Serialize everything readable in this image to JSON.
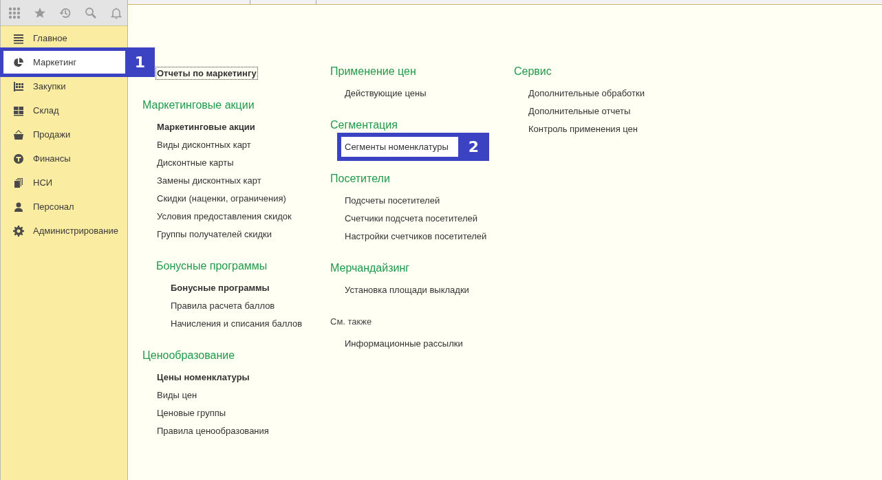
{
  "sidebar": {
    "items": [
      {
        "label": "Главное",
        "selected": false
      },
      {
        "label": "Маркетинг",
        "selected": true,
        "callout": "1"
      },
      {
        "label": "Закупки",
        "selected": false
      },
      {
        "label": "Склад",
        "selected": false
      },
      {
        "label": "Продажи",
        "selected": false
      },
      {
        "label": "Финансы",
        "selected": false
      },
      {
        "label": "НСИ",
        "selected": false
      },
      {
        "label": "Персонал",
        "selected": false
      },
      {
        "label": "Администрирование",
        "selected": false
      }
    ]
  },
  "columns": [
    {
      "entries": [
        {
          "kind": "link",
          "label": "Отчеты по маркетингу",
          "bold": true,
          "focused": true
        },
        {
          "kind": "group",
          "heading": "Маркетинговые акции",
          "items": [
            {
              "label": "Маркетинговые акции",
              "bold": true
            },
            {
              "label": "Виды дисконтных карт",
              "bold": false
            },
            {
              "label": "Дисконтные карты",
              "bold": false
            },
            {
              "label": "Замены дисконтных карт",
              "bold": false
            },
            {
              "label": "Скидки (наценки, ограничения)",
              "bold": false
            },
            {
              "label": "Условия предоставления скидок",
              "bold": false
            },
            {
              "label": "Группы получателей скидки",
              "bold": false
            }
          ],
          "children": [
            {
              "heading": "Бонусные программы",
              "items": [
                {
                  "label": "Бонусные программы",
                  "bold": true
                },
                {
                  "label": "Правила расчета баллов",
                  "bold": false
                },
                {
                  "label": "Начисления и списания баллов",
                  "bold": false
                }
              ]
            }
          ]
        },
        {
          "kind": "group",
          "heading": "Ценообразование",
          "items": [
            {
              "label": "Цены номенклатуры",
              "bold": true
            },
            {
              "label": "Виды цен",
              "bold": false
            },
            {
              "label": "Ценовые группы",
              "bold": false
            },
            {
              "label": "Правила ценообразования",
              "bold": false
            }
          ]
        }
      ]
    },
    {
      "entries": [
        {
          "kind": "group",
          "heading": "Применение цен",
          "items": [
            {
              "label": "Действующие цены",
              "bold": false
            }
          ]
        },
        {
          "kind": "group",
          "heading": "Сегментация",
          "items": [
            {
              "label": "Сегменты номенклатуры",
              "bold": false,
              "callout": "2"
            }
          ]
        },
        {
          "kind": "group",
          "heading": "Посетители",
          "items": [
            {
              "label": "Подсчеты посетителей",
              "bold": false
            },
            {
              "label": "Счетчики подсчета посетителей",
              "bold": false
            },
            {
              "label": "Настройки счетчиков посетителей",
              "bold": false
            }
          ]
        },
        {
          "kind": "group",
          "heading": "Мерчандайзинг",
          "items": [
            {
              "label": "Установка площади выкладки",
              "bold": false
            }
          ]
        },
        {
          "kind": "see-also",
          "heading": "См. также",
          "items": [
            {
              "label": "Информационные рассылки",
              "bold": false
            }
          ]
        }
      ]
    },
    {
      "entries": [
        {
          "kind": "group",
          "heading": "Сервис",
          "items": [
            {
              "label": "Дополнительные обработки",
              "bold": false
            },
            {
              "label": "Дополнительные отчеты",
              "bold": false
            },
            {
              "label": "Контроль применения цен",
              "bold": false
            }
          ]
        }
      ]
    }
  ]
}
